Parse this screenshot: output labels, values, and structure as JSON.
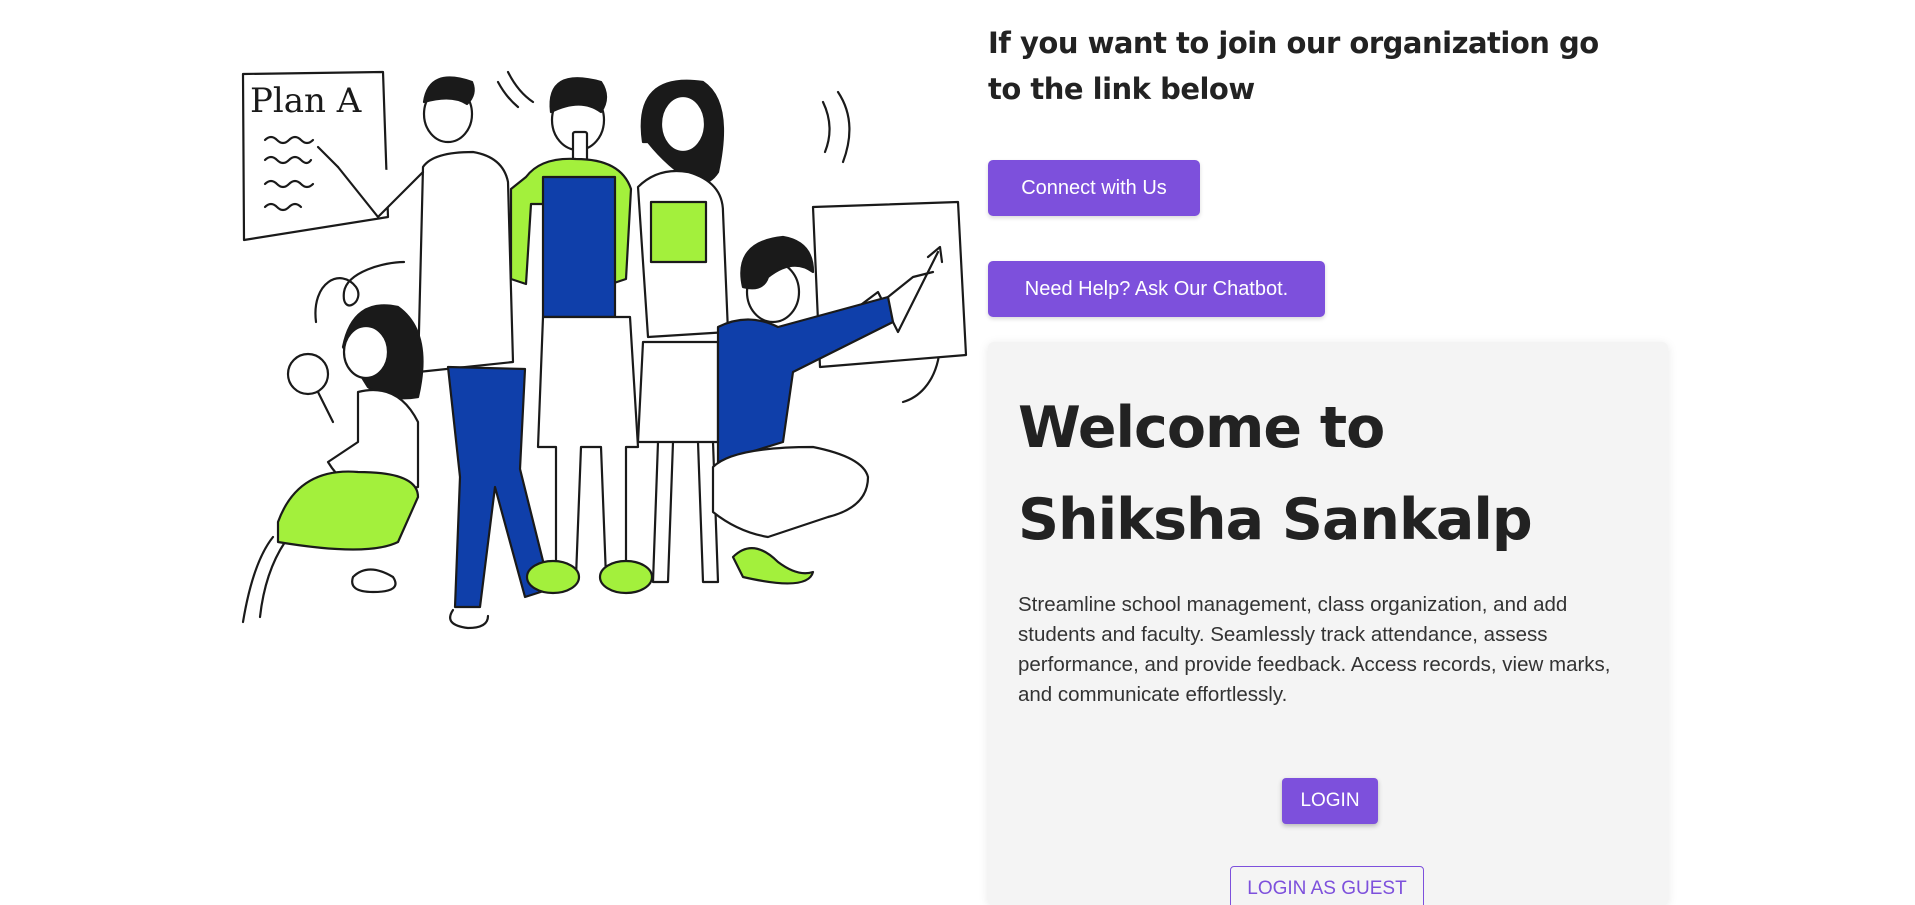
{
  "join": {
    "heading": "If you want to join our organization go to the link below",
    "connect_label": "Connect with Us",
    "chatbot_label": "Need Help? Ask Our Chatbot."
  },
  "welcome": {
    "title_line1": "Welcome to",
    "title_line2": "Shiksha Sankalp",
    "description": "Streamline school management, class organization, and add students and faculty. Seamlessly track attendance, assess performance, and provide feedback. Access records, view marks, and communicate effortlessly.",
    "login_label": "LOGIN",
    "guest_label": "LOGIN AS GUEST"
  },
  "illustration": {
    "whiteboard_text": "Plan A"
  },
  "colors": {
    "accent": "#7d50dc",
    "card_bg": "#f4f4f4",
    "illustration_green": "#a3f03c",
    "illustration_blue": "#0f3faa"
  }
}
